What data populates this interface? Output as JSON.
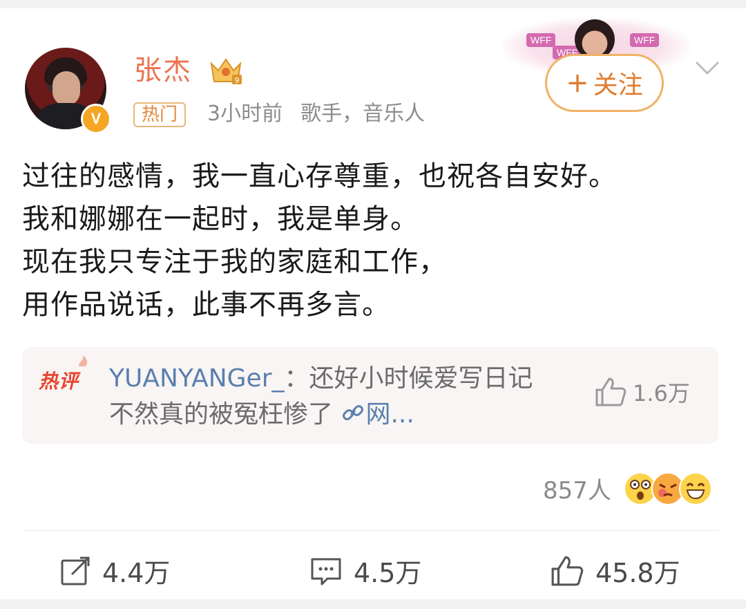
{
  "post": {
    "author": {
      "name": "张杰",
      "badge_hot": "热门",
      "time": "3小时前",
      "description": "歌手，音乐人",
      "verified_mark": "V"
    },
    "follow_label": "关注",
    "follow_deco_tags": [
      "WFF",
      "WFF",
      "WFF"
    ],
    "text_lines": [
      "过往的感情，我一直心存尊重，也祝各自安好。",
      "我和娜娜在一起时，我是单身。",
      "现在我只专注于我的家庭和工作，",
      "用作品说话，此事不再多言。"
    ],
    "hot_comment": {
      "label": "热评",
      "user": "YUANYANGer_",
      "separator": "：",
      "text": "还好小时候爱写日记 不然真的被冤枉惨了",
      "link_text": "网...",
      "likes": "1.6万"
    },
    "reactions": {
      "count": "857人",
      "emoji_icons": [
        "shocked-face-icon",
        "angry-face-icon",
        "laughing-face-icon"
      ]
    },
    "actions": {
      "repost": "4.4万",
      "comments": "4.5万",
      "likes": "45.8万"
    },
    "colors": {
      "username": "#eb7350",
      "follow": "#e07b2e",
      "hot_label": "#e8452e",
      "comment_user": "#5b7fae"
    }
  }
}
